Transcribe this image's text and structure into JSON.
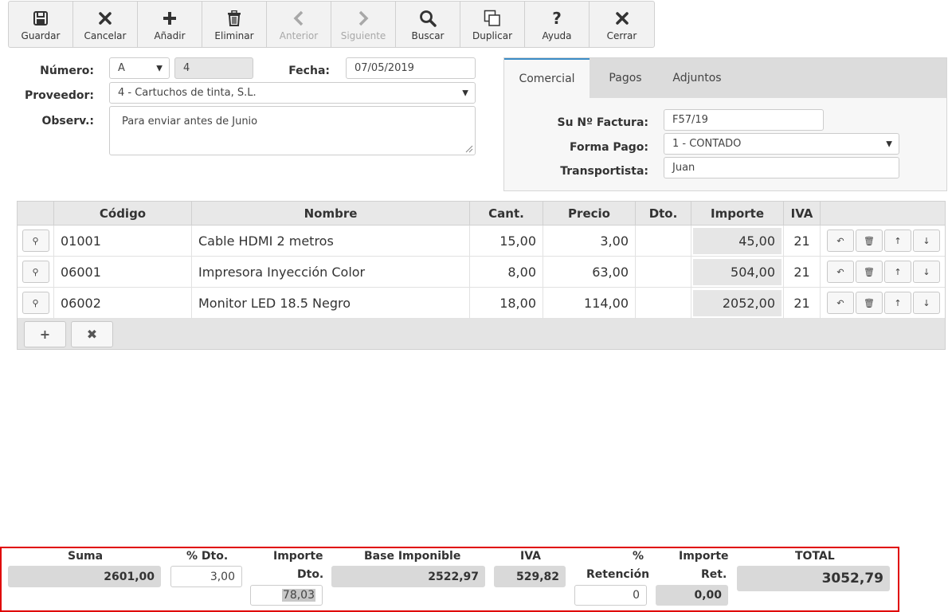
{
  "toolbar": [
    {
      "label": "Guardar",
      "icon": "save-icon",
      "disabled": false
    },
    {
      "label": "Cancelar",
      "icon": "cancel-icon",
      "disabled": false
    },
    {
      "label": "Añadir",
      "icon": "plus-icon",
      "disabled": false
    },
    {
      "label": "Eliminar",
      "icon": "trash-icon",
      "disabled": false
    },
    {
      "label": "Anterior",
      "icon": "chevron-left-icon",
      "disabled": true
    },
    {
      "label": "Siguiente",
      "icon": "chevron-right-icon",
      "disabled": true
    },
    {
      "label": "Buscar",
      "icon": "search-icon",
      "disabled": false
    },
    {
      "label": "Duplicar",
      "icon": "duplicate-icon",
      "disabled": false
    },
    {
      "label": "Ayuda",
      "icon": "help-icon",
      "disabled": false
    },
    {
      "label": "Cerrar",
      "icon": "close-icon",
      "disabled": false
    }
  ],
  "header": {
    "numero_label": "Número:",
    "serie": "A",
    "numero": "4",
    "fecha_label": "Fecha:",
    "fecha": "07/05/2019",
    "proveedor_label": "Proveedor:",
    "proveedor": "4 - Cartuchos de tinta, S.L.",
    "observ_label": "Observ.:",
    "observ": "Para enviar antes de Junio"
  },
  "tabs": {
    "items": [
      "Comercial",
      "Pagos",
      "Adjuntos"
    ],
    "active": "Comercial",
    "factura_label": "Su Nº Factura:",
    "factura": "F57/19",
    "forma_pago_label": "Forma Pago:",
    "forma_pago": "1 - CONTADO",
    "transportista_label": "Transportista:",
    "transportista": "Juan"
  },
  "grid": {
    "columns": [
      "Código",
      "Nombre",
      "Cant.",
      "Precio",
      "Dto.",
      "Importe",
      "IVA"
    ],
    "rows": [
      {
        "codigo": "01001",
        "nombre": "Cable HDMI 2 metros",
        "cant": "15,00",
        "precio": "3,00",
        "dto": "",
        "importe": "45,00",
        "iva": "21"
      },
      {
        "codigo": "06001",
        "nombre": "Impresora Inyección Color",
        "cant": "8,00",
        "precio": "63,00",
        "dto": "",
        "importe": "504,00",
        "iva": "21"
      },
      {
        "codigo": "06002",
        "nombre": "Monitor LED 18.5 Negro",
        "cant": "18,00",
        "precio": "114,00",
        "dto": "",
        "importe": "2052,00",
        "iva": "21"
      }
    ]
  },
  "totals": {
    "suma_label": "Suma",
    "suma": "2601,00",
    "pct_dto_label": "% Dto.",
    "pct_dto": "3,00",
    "importe_label": "Importe",
    "dto_label": "Dto.",
    "importe_dto": "78,03",
    "base_label": "Base Imponible",
    "base": "2522,97",
    "iva_label": "IVA",
    "iva": "529,82",
    "pct_label": "%",
    "retencion_label": "Retención",
    "pct_retencion": "0",
    "importe_ret_label": "Importe",
    "ret_label": "Ret.",
    "importe_ret": "0,00",
    "total_label": "TOTAL",
    "total": "3052,79"
  },
  "colors": {
    "accent": "#3b8cc6",
    "highlight_border": "#e00000"
  }
}
